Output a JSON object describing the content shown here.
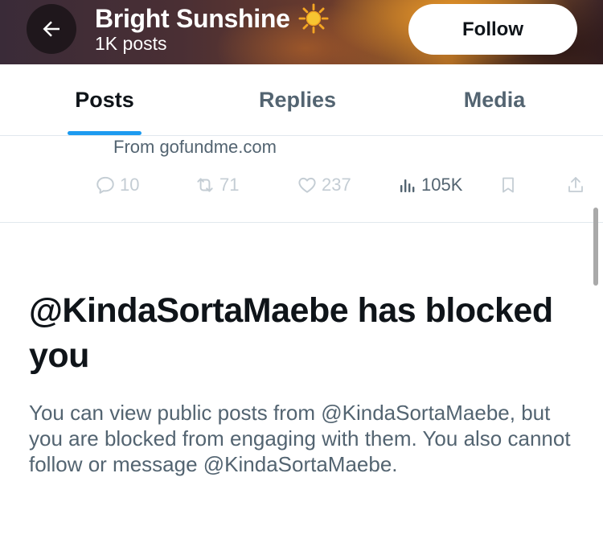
{
  "header": {
    "title": "Bright Sunshine",
    "title_emoji": "☀️",
    "post_count": "1K posts",
    "follow_label": "Follow",
    "back_icon": "arrow-left-icon"
  },
  "tabs": [
    {
      "label": "Posts",
      "active": true
    },
    {
      "label": "Replies",
      "active": false
    },
    {
      "label": "Media",
      "active": false
    }
  ],
  "post": {
    "source_text": "From gofundme.com",
    "replies": "10",
    "reposts": "71",
    "likes": "237",
    "views": "105K"
  },
  "blocked": {
    "title": "@KindaSortaMaebe has blocked you",
    "body": "You can view public posts from @KindaSortaMaebe, but you are blocked from engaging with them. You also cannot follow or message @KindaSortaMaebe."
  },
  "colors": {
    "accent": "#1d9bf0",
    "primary_text": "#0f1419",
    "secondary_text": "#536471",
    "muted_icon": "#c4cdd4"
  }
}
